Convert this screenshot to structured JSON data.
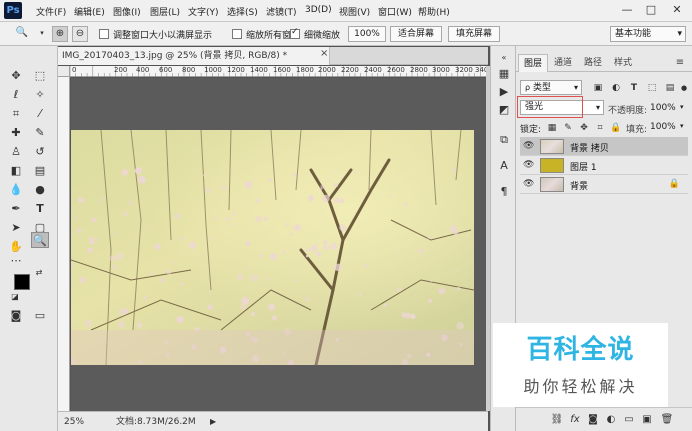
{
  "app": {
    "logo": "Ps"
  },
  "menu": [
    "文件(F)",
    "编辑(E)",
    "图像(I)",
    "图层(L)",
    "文字(Y)",
    "选择(S)",
    "滤镜(T)",
    "3D(D)",
    "视图(V)",
    "窗口(W)",
    "帮助(H)"
  ],
  "window_controls": {
    "minimize": "—",
    "maximize": "□",
    "close": "✕"
  },
  "options": {
    "resize_windows_label": "调整窗口大小以满屏显示",
    "zoom_all_label": "缩放所有窗口",
    "scrubby_zoom_label": "细微缩放",
    "zoom_value": "100%",
    "fit_screen": "适合屏幕",
    "fill_screen": "填充屏幕",
    "workspace": "基本功能"
  },
  "document": {
    "tab_title": "IMG_20170403_13.jpg @ 25% (背景 拷贝, RGB/8) *",
    "close": "×",
    "ruler_labels": [
      "0",
      "200",
      "400",
      "600",
      "800",
      "1000",
      "1200",
      "1400",
      "1600",
      "1800",
      "2000",
      "2200",
      "2400",
      "2600",
      "2800",
      "3000",
      "3200",
      "3400"
    ]
  },
  "status": {
    "zoom": "25%",
    "doc_size": "文档:8.73M/26.2M"
  },
  "layers_panel": {
    "tabs": [
      "图层",
      "通道",
      "路径",
      "样式"
    ],
    "filter_kind": "类型",
    "blend_mode": "强光",
    "opacity_label": "不透明度:",
    "opacity_value": "100%",
    "lock_label": "锁定:",
    "fill_label": "填充:",
    "fill_value": "100%",
    "layers": [
      {
        "name": "背景 拷贝",
        "selected": true,
        "locked": false
      },
      {
        "name": "图层 1",
        "selected": false,
        "locked": false
      },
      {
        "name": "背景",
        "selected": false,
        "locked": true
      }
    ]
  },
  "watermark": {
    "title": "百科全说",
    "subtitle": "助你轻松解决"
  },
  "colors": {
    "accent_watermark": "#2fb5e3",
    "highlight_border": "#e05050"
  }
}
